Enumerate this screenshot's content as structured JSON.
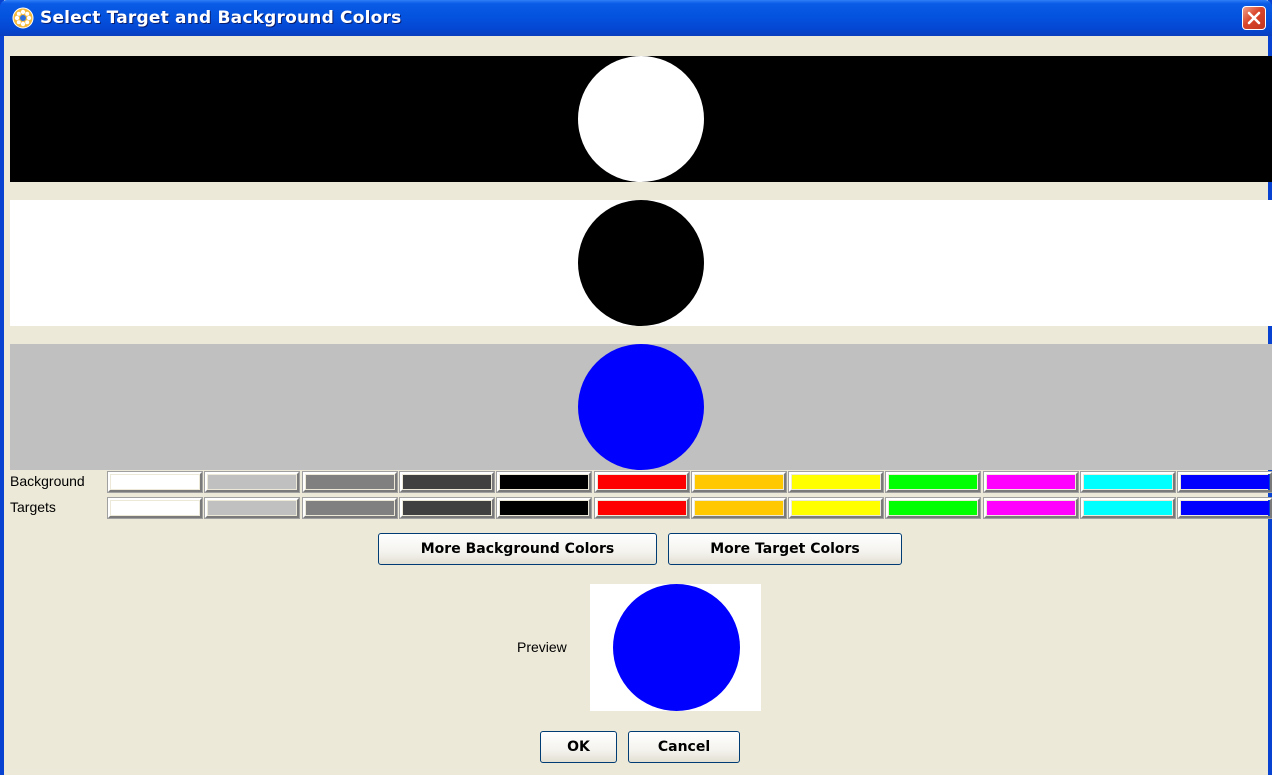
{
  "window": {
    "title": "Select Target and Background Colors",
    "title_color": "#FFFFFF",
    "titlebar_color": "#0453DF"
  },
  "bands": [
    {
      "background": "#000000",
      "target": "#FFFFFF"
    },
    {
      "background": "#FFFFFF",
      "target": "#000000"
    },
    {
      "background": "#C0C0C0",
      "target": "#0000FF"
    }
  ],
  "palette": {
    "background_label": "Background",
    "targets_label": "Targets",
    "colors": [
      "#FFFFFF",
      "#C0C0C0",
      "#808080",
      "#404040",
      "#000000",
      "#FF0000",
      "#FFC800",
      "#FFFF00",
      "#00FF00",
      "#FF00FF",
      "#00FFFF",
      "#0000FF"
    ]
  },
  "buttons": {
    "more_background": "More Background Colors",
    "more_target": "More Target Colors",
    "ok": "OK",
    "cancel": "Cancel"
  },
  "preview": {
    "label": "Preview",
    "background": "#FFFFFF",
    "target": "#0000FF"
  },
  "icons": {
    "app": "java-cup-icon",
    "close": "close-icon"
  }
}
